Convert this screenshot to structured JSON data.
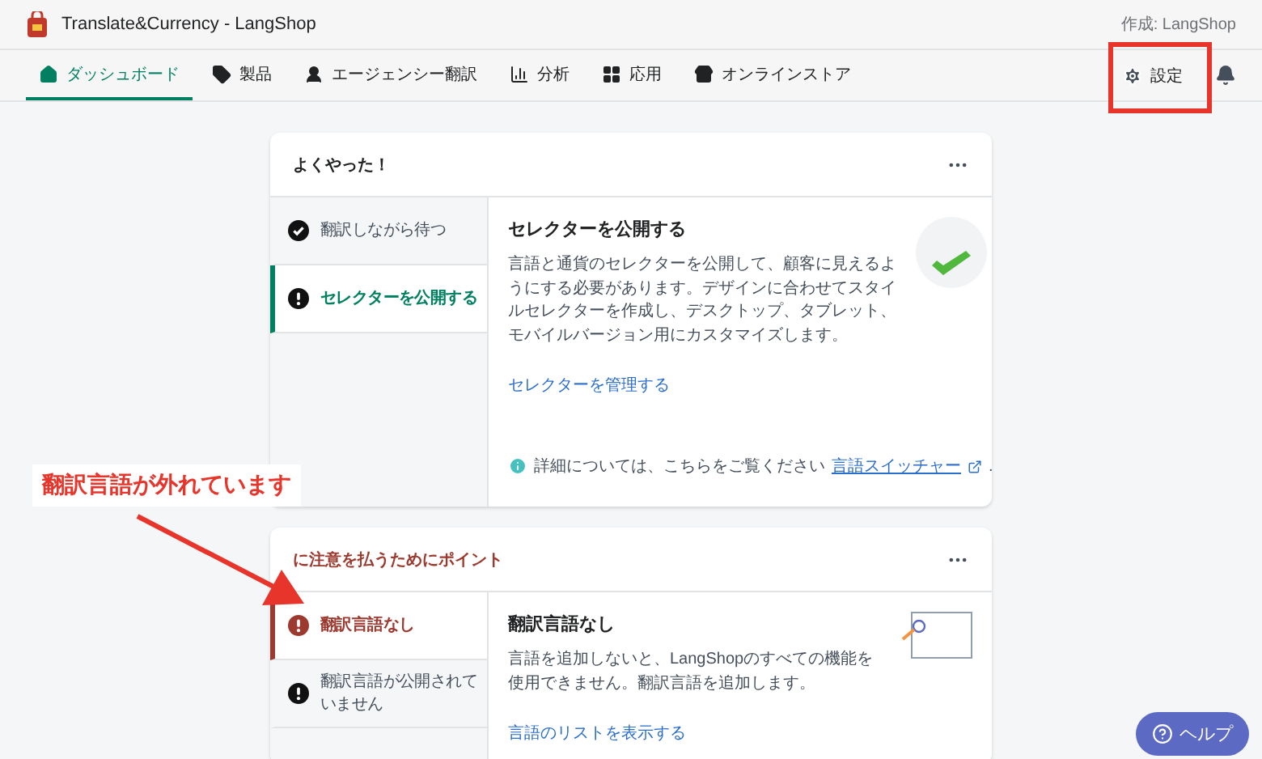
{
  "app": {
    "title": "Translate&Currency - LangShop",
    "author": "作成: LangShop"
  },
  "nav": {
    "items": [
      {
        "label": "ダッシュボード",
        "selected": true
      },
      {
        "label": "製品",
        "selected": false
      },
      {
        "label": "エージェンシー翻訳",
        "selected": false
      },
      {
        "label": "分析",
        "selected": false
      },
      {
        "label": "応用",
        "selected": false
      },
      {
        "label": "オンラインストア",
        "selected": false
      }
    ],
    "settings": "設定"
  },
  "cards": [
    {
      "title": "よくやった！",
      "critical": false,
      "steps": [
        {
          "label": "翻訳しながら待つ",
          "done": true,
          "selected": false
        },
        {
          "label": "セレクターを公開する",
          "done": false,
          "selected": true
        }
      ],
      "detail": {
        "heading": "セレクターを公開する",
        "body": "言語と通貨のセレクターを公開して、顧客に見えるようにする必要があります。デザインに合わせてスタイルセレクターを作成し、デスクトップ、タブレット、モバイルバージョン用にカスタマイズします。",
        "link": "セレクターを管理する",
        "note": {
          "text": "詳細については、こちらをご覧ください",
          "link": "言語スイッチャー",
          "end": "."
        }
      }
    },
    {
      "title": "に注意を払うためにポイント",
      "critical": true,
      "steps": [
        {
          "label": "翻訳言語なし",
          "done": false,
          "selected": true
        },
        {
          "label": "翻訳言語が公開されていません",
          "done": false,
          "selected": false
        }
      ],
      "detail": {
        "heading": "翻訳言語なし",
        "body": "言語を追加しないと、LangShopのすべての機能を使用できません。翻訳言語を追加します。",
        "link": "言語のリストを表示する"
      }
    }
  ],
  "annotation": {
    "text": "翻訳言語が外れています"
  },
  "help": {
    "label": "ヘルプ"
  }
}
